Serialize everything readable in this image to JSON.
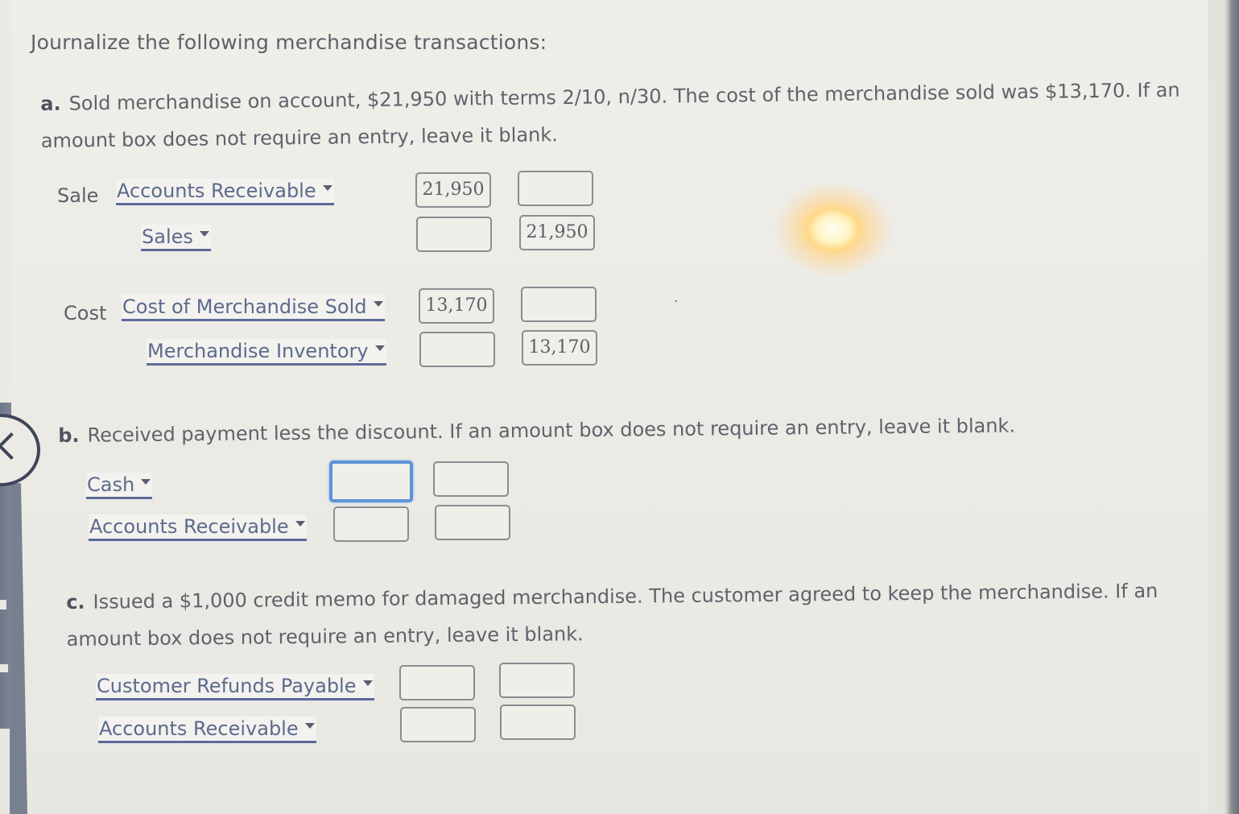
{
  "title": "Journalize the following merchandise transactions:",
  "questions": {
    "a": {
      "label": "a.",
      "text": "Sold merchandise on account, $21,950 with terms 2/10, n/30. The cost of the merchandise sold was $13,170. If an amount box does not require an entry, leave it blank.",
      "sale": {
        "row_label": "Sale",
        "debit_account": "Accounts Receivable",
        "debit_amount": "21,950",
        "debit_credit_box": "",
        "credit_account": "Sales",
        "credit_debit_box": "",
        "credit_amount": "21,950"
      },
      "cost": {
        "row_label": "Cost",
        "debit_account": "Cost of Merchandise Sold",
        "debit_amount": "13,170",
        "debit_credit_box": "",
        "credit_account": "Merchandise Inventory",
        "credit_debit_box": "",
        "credit_amount": "13,170"
      }
    },
    "b": {
      "label": "b.",
      "text": "Received payment less the discount. If an amount box does not require an entry, leave it blank.",
      "rows": [
        {
          "account": "Cash",
          "debit": "",
          "credit": ""
        },
        {
          "account": "Accounts Receivable",
          "debit": "",
          "credit": ""
        }
      ]
    },
    "c": {
      "label": "c.",
      "text": "Issued a $1,000 credit memo for damaged merchandise. The customer agreed to keep the merchandise. If an amount box does not require an entry, leave it blank.",
      "rows": [
        {
          "account": "Customer Refunds Payable",
          "debit": "",
          "credit": ""
        },
        {
          "account": "Accounts Receivable",
          "debit": "",
          "credit": ""
        }
      ]
    }
  },
  "icons": {
    "back": "chevron-left-icon",
    "dropdown": "caret-down-icon"
  },
  "colors": {
    "link_blue": "#5c6a8e",
    "focus_blue": "#5c93d8",
    "text_gray": "#5f626a"
  }
}
